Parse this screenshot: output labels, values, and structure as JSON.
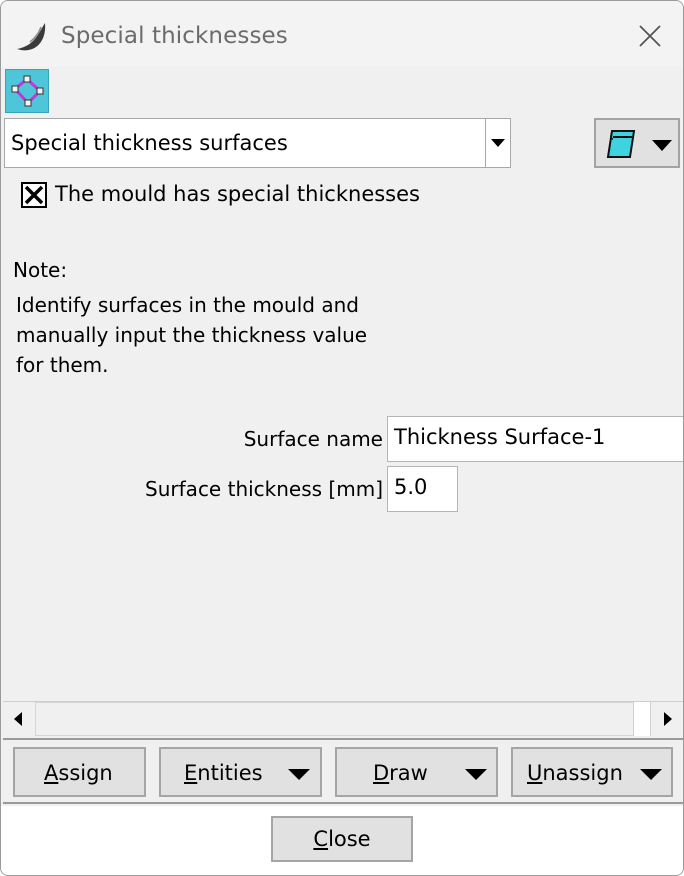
{
  "window": {
    "title": "Special thicknesses",
    "app_icon": "swoosh-logo-icon",
    "close_icon": "close-icon"
  },
  "toolbar": {
    "icon": "surface-select-icon",
    "accent_color": "#4ec5d8"
  },
  "mode_select": {
    "selected": "Special thickness surfaces",
    "menu_icon": "notepad-icon"
  },
  "special_checkbox": {
    "checked": true,
    "label": "The mould has special thicknesses"
  },
  "note": {
    "title": "Note:",
    "line1": "Identify surfaces in the mould and",
    "line2": "manually input the thickness value",
    "line3": "for them."
  },
  "fields": {
    "surface_name_label": "Surface name",
    "surface_name_value": "Thickness Surface-1",
    "surface_thickness_label": "Surface thickness [mm]",
    "surface_thickness_value": "5.0"
  },
  "buttons": {
    "assign_mnemonic": "A",
    "assign_rest": "ssign",
    "entities_mnemonic": "E",
    "entities_rest": "ntities",
    "draw_mnemonic": "D",
    "draw_rest": "raw",
    "unassign_mnemonic": "U",
    "unassign_rest": "nassign",
    "close_mnemonic": "C",
    "close_rest": "lose"
  }
}
